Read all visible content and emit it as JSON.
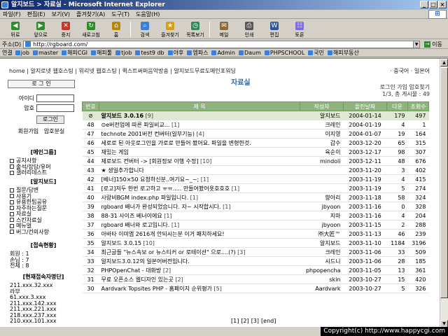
{
  "window": {
    "title": "알지보드 > 자료실 - Microsoft Internet Explorer"
  },
  "menu": [
    "파일(F)",
    "편집(E)",
    "보기(V)",
    "즐겨찾기(A)",
    "도구(T)",
    "도움말(H)"
  ],
  "toolbar": {
    "buttons": [
      {
        "label": "뒤로",
        "icon": "back-arrow-icon",
        "color": "#2e8b2e",
        "glyph": "◀"
      },
      {
        "label": "앞으로",
        "icon": "forward-arrow-icon",
        "color": "#2e8b2e",
        "glyph": "▶"
      },
      {
        "label": "중지",
        "icon": "stop-icon",
        "color": "#c0392b",
        "glyph": "✕"
      },
      {
        "label": "새로고침",
        "icon": "refresh-icon",
        "color": "#2e8b2e",
        "glyph": "↻"
      },
      {
        "label": "홈",
        "icon": "home-icon",
        "color": "#b8860b",
        "glyph": "⌂"
      },
      {
        "label": "검색",
        "icon": "search-icon",
        "color": "#3b7fd6",
        "glyph": "⌕"
      },
      {
        "label": "즐겨찾기",
        "icon": "favorites-icon",
        "color": "#d4a017",
        "glyph": "★"
      },
      {
        "label": "목록보기",
        "icon": "history-icon",
        "color": "#2e8b57",
        "glyph": "◷"
      },
      {
        "label": "메일",
        "icon": "mail-icon",
        "color": "#8a6d3b",
        "glyph": "✉"
      },
      {
        "label": "인쇄",
        "icon": "print-icon",
        "color": "#555555",
        "glyph": "⎙"
      },
      {
        "label": "편집",
        "icon": "edit-icon",
        "color": "#2b579a",
        "glyph": "W"
      },
      {
        "label": "토론",
        "icon": "discuss-icon",
        "color": "#7b68ee",
        "glyph": "☷"
      }
    ]
  },
  "address": {
    "label": "주소(D)",
    "url": "http://rgboard.com/",
    "go": "이동"
  },
  "links": {
    "label": "연결",
    "items": [
      "job",
      "master",
      "해피CGI",
      "해피툴",
      "tjob",
      "test9 db",
      "야후",
      "엠파스",
      "Admin",
      "Daum",
      "PHPSCHOOL",
      "국민",
      "해피부동산"
    ]
  },
  "page": {
    "top_nav": "home | 알지로넷 웹호스팅 | 위리넷 웹호스팅 | 퀵스트써퍼음악방송 | 알지보드무료도메인포워딩",
    "top_right": "· 중국어 · 일본어",
    "title": "자료실",
    "stat_line1": "로그인 가입 암호찾기",
    "stat_line2": "1/3, 총 게시물 : 49"
  },
  "login": {
    "header": "로 그 인",
    "id_label": "아이디",
    "pw_label": "암호",
    "button": "로그인",
    "join": "회원가입",
    "find_pw": "암호분실"
  },
  "sidebar": {
    "main_group_title": "[메인그룹]",
    "main_group": [
      "공지사항",
      "출석/잡담/유머",
      "갤러리데스트"
    ],
    "board_title": "[알지보드]",
    "board": [
      "질문/답변",
      "사용기",
      "유용한팁공유",
      "자주하는질문",
      "자료실",
      "스킨자료실",
      "메뉴얼",
      "버그/건의사항"
    ],
    "stats_title": "[접속현황]",
    "stats": [
      "회원 : 1",
      "손님 : 7",
      "전체 : 8"
    ],
    "ips_title": "[현재접속자명단]",
    "ips": [
      "211.xxx.32.xxx",
      "라부",
      "61.xxx.3.xxx",
      "211.xxx.142.xxx",
      "211.xxx.221.xxx",
      "218.xxx.237.xxx",
      "210.xxx.101.xxx"
    ]
  },
  "table": {
    "headers": [
      "번호",
      "제 목",
      "작성자",
      "올린날짜",
      "다운",
      "조회수"
    ],
    "rows": [
      {
        "no": "⊘",
        "title": "알지보드 3.0.16",
        "suffix": " [9]",
        "author": "알지보드",
        "date": "2004-01-14",
        "down": "179",
        "hits": "497",
        "hl": true,
        "bold": true
      },
      {
        "no": "48",
        "title": "⊙e버전업에 따른 파일비교...",
        "suffix": " [1]",
        "author": "크레인",
        "date": "2004-01-19",
        "down": "4",
        "hits": "1"
      },
      {
        "no": "47",
        "title": "technote 2001버전 컨버터(일부기능)",
        "suffix": " [4]",
        "author": "이지영",
        "date": "2004-01-07",
        "down": "19",
        "hits": "164"
      },
      {
        "no": "46",
        "title": "세로로 된 아웃로그인을 가로로 만들어 봤어요. 파일을 변형한것.",
        "suffix": "",
        "author": "갑수",
        "date": "2003-12-20",
        "down": "65",
        "hits": "315"
      },
      {
        "no": "45",
        "title": "재밌는 게임",
        "suffix": "",
        "author": "육순이",
        "date": "2003-12-17",
        "down": "98",
        "hits": "307"
      },
      {
        "no": "44",
        "title": "제로보드 컨버터 -> [회원정보 이행 수정]",
        "suffix": " [10]",
        "author": "mindoli",
        "date": "2003-12-11",
        "down": "48",
        "hits": "676"
      },
      {
        "no": "43",
        "title": "★ 생일추가합니다",
        "suffix": "",
        "author": "",
        "date": "2003-11-20",
        "down": "3",
        "hits": "402"
      },
      {
        "no": "42",
        "title": "[베너]150×50 요청하신분..여기요~_~;",
        "suffix": " [1]",
        "author": "",
        "date": "2003-11-19",
        "down": "4",
        "hits": "415"
      },
      {
        "no": "41",
        "title": "[로고]저두 한번 로고하고 ㅠㅠ..... 만들어봤어욧호호호",
        "suffix": " [1]",
        "author": "",
        "date": "2003-11-19",
        "down": "5",
        "hits": "274"
      },
      {
        "no": "40",
        "title": "사랑비BGM index.php 파일입니다.",
        "suffix": " [1]",
        "author": "향아리",
        "date": "2003-11-18",
        "down": "58",
        "hits": "324"
      },
      {
        "no": "39",
        "title": "rgboard 배너가 완성되었습니다. 자~ 시작합시다.",
        "suffix": " [1]",
        "author": "jbyoon",
        "date": "2003-11-16",
        "down": "0",
        "hits": "328"
      },
      {
        "no": "38",
        "title": "88-31 사이즈 베너이에요",
        "suffix": " [1]",
        "author": "지마",
        "date": "2003-11-16",
        "down": "4",
        "hits": "204"
      },
      {
        "no": "37",
        "title": "rgboard 배너와 로고입니다.",
        "suffix": " [1]",
        "author": "jbyoon",
        "date": "2003-11-15",
        "down": "2",
        "hits": "288"
      },
      {
        "no": "36",
        "title": "아바타 이미엠 2616개 안되시는분 이거 패치하세요!",
        "suffix": "",
        "author": "㈜大匠™",
        "date": "2003-11-13",
        "down": "46",
        "hits": "239"
      },
      {
        "no": "35",
        "title": "알지보드 3.0.15",
        "suffix": " [10]",
        "author": "알지보드",
        "date": "2003-11-10",
        "down": "1184",
        "hits": "3196"
      },
      {
        "no": "34",
        "title": "최근글들 \"뉴스속보 or 뉴스티커 or 로테이션\" 으로....(?)",
        "suffix": " [3]",
        "author": "크레인",
        "date": "2003-11-06",
        "down": "33",
        "hits": "509"
      },
      {
        "no": "33",
        "title": "알지보드3.0.12의 일본어버전입니다.",
        "suffix": "",
        "author": "시드니",
        "date": "2003-11-06",
        "down": "28",
        "hits": "185"
      },
      {
        "no": "32",
        "title": "PHPOpenChat - 대화방",
        "suffix": " [2]",
        "author": "phpopencha",
        "date": "2003-11-05",
        "down": "13",
        "hits": "361"
      },
      {
        "no": "31",
        "title": "무료 오픈소스 웹디자인 있는곳",
        "suffix": " [2]",
        "author": "skin",
        "date": "2003-10-27",
        "down": "15",
        "hits": "420"
      },
      {
        "no": "30",
        "title": "Aardvark Topsites PHP - 홈페이지 순위평가",
        "suffix": " [5]",
        "author": "Aardvark",
        "date": "2003-10-27",
        "down": "5",
        "hits": "326"
      }
    ]
  },
  "pager": [
    "[1]",
    "[2]",
    "[3]",
    "[end]"
  ],
  "copyright": "Copyright(c) http://www.happycgi.com",
  "colors": {
    "header_bg": "#8fb37d",
    "title_blue": "#2b6cb5",
    "highlight_row": "#dfe9d5"
  }
}
